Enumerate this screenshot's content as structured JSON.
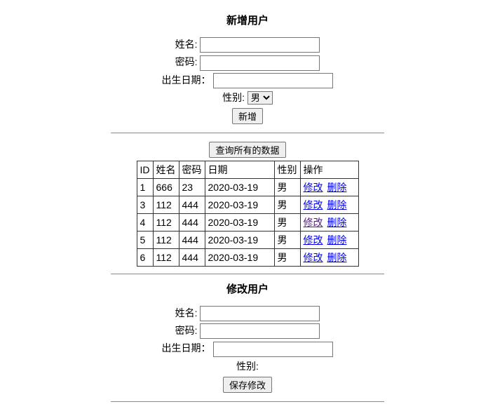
{
  "addForm": {
    "title": "新增用户",
    "nameLabel": "姓名:",
    "passwordLabel": "密码:",
    "birthLabel": "出生日期：",
    "genderLabel": "性别:",
    "genderSelected": "男",
    "submitLabel": "新增"
  },
  "querySection": {
    "queryAllLabel": "查询所有的数据",
    "headers": {
      "id": "ID",
      "name": "姓名",
      "password": "密码",
      "date": "日期",
      "gender": "性别",
      "ops": "操作"
    },
    "editLabel": "修改",
    "deleteLabel": "删除",
    "rows": [
      {
        "id": "1",
        "name": "666",
        "password": "23",
        "date": "2020-03-19",
        "gender": "男",
        "editVisited": false
      },
      {
        "id": "3",
        "name": "112",
        "password": "444",
        "date": "2020-03-19",
        "gender": "男",
        "editVisited": false
      },
      {
        "id": "4",
        "name": "112",
        "password": "444",
        "date": "2020-03-19",
        "gender": "男",
        "editVisited": true
      },
      {
        "id": "5",
        "name": "112",
        "password": "444",
        "date": "2020-03-19",
        "gender": "男",
        "editVisited": false
      },
      {
        "id": "6",
        "name": "112",
        "password": "444",
        "date": "2020-03-19",
        "gender": "男",
        "editVisited": false
      }
    ]
  },
  "editForm": {
    "title": "修改用户",
    "nameLabel": "姓名:",
    "passwordLabel": "密码:",
    "birthLabel": "出生日期：",
    "genderLabel": "性别:",
    "submitLabel": "保存修改"
  }
}
